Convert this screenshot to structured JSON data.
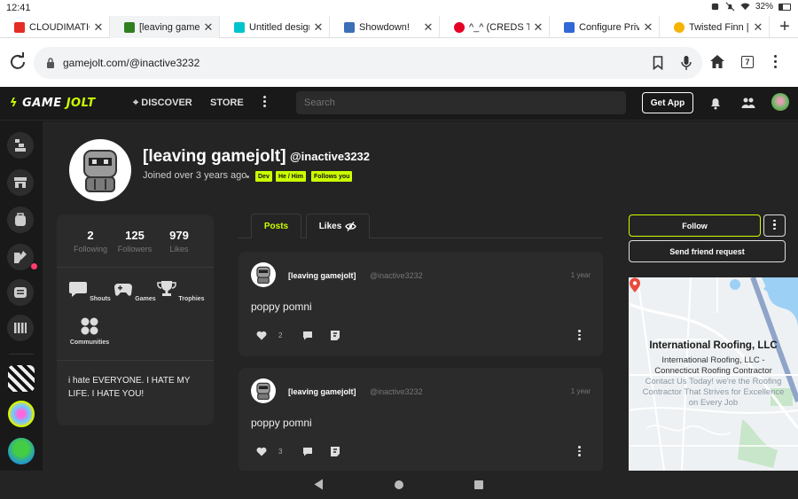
{
  "status_bar": {
    "time": "12:41",
    "battery": "32%"
  },
  "browser": {
    "tabs": [
      {
        "title": "CLOUDIMATIONS",
        "color": "#e52d27"
      },
      {
        "title": "[leaving gamejolt]",
        "color": "#2f7f1f"
      },
      {
        "title": "Untitled design - V",
        "color": "#00c4cc"
      },
      {
        "title": "Showdown!",
        "color": "#3b6fb6"
      },
      {
        "title": "^_^ (CREDS TO CH",
        "color": "#e60023"
      },
      {
        "title": "Configure Private",
        "color": "#3367d6"
      },
      {
        "title": "Twisted Finn | Dan",
        "color": "#f4b400"
      }
    ],
    "url": "gamejolt.com/@inactive3232",
    "tab_count": "7"
  },
  "gamejolt": {
    "logo_game": "GAME",
    "logo_jolt": "JOLT",
    "nav_discover": "DISCOVER",
    "nav_store": "STORE",
    "search_placeholder": "Search",
    "get_app": "Get App"
  },
  "profile": {
    "display_name": "[leaving gamejolt]",
    "handle": "@inactive3232",
    "joined": "Joined over 3 years ago",
    "tags": [
      "Dev",
      "He / Him",
      "Follows you"
    ],
    "stats": [
      {
        "value": "2",
        "label": "Following"
      },
      {
        "value": "125",
        "label": "Followers"
      },
      {
        "value": "979",
        "label": "Likes"
      }
    ],
    "shortcuts": [
      {
        "label": "Shouts",
        "icon": "shouts-icon"
      },
      {
        "label": "Games",
        "icon": "games-icon"
      },
      {
        "label": "Trophies",
        "icon": "trophy-icon"
      },
      {
        "label": "Communities",
        "icon": "communities-icon"
      }
    ],
    "bio": "i hate EVERYONE. I HATE MY LIFE. I HATE YOU!",
    "follow": "Follow",
    "friend_request": "Send friend request"
  },
  "feed": {
    "tabs": {
      "posts": "Posts",
      "likes": "Likes"
    },
    "posts": [
      {
        "author": "[leaving gamejolt]",
        "handle": "@inactive3232",
        "time": "1 year",
        "body": "poppy pomni",
        "likes": "2"
      },
      {
        "author": "[leaving gamejolt]",
        "handle": "@inactive3232",
        "time": "1 year",
        "body": "poppy pomni",
        "likes": "3"
      }
    ]
  },
  "ad": {
    "title": "International Roofing, LLC",
    "lines": [
      "International Roofing, LLC -",
      "Connecticut Roofing Contractor"
    ],
    "faint_lines": [
      "Contact Us Today! we're the Roofing",
      "Contractor That Strives for Excellence",
      "on Every Job"
    ]
  }
}
